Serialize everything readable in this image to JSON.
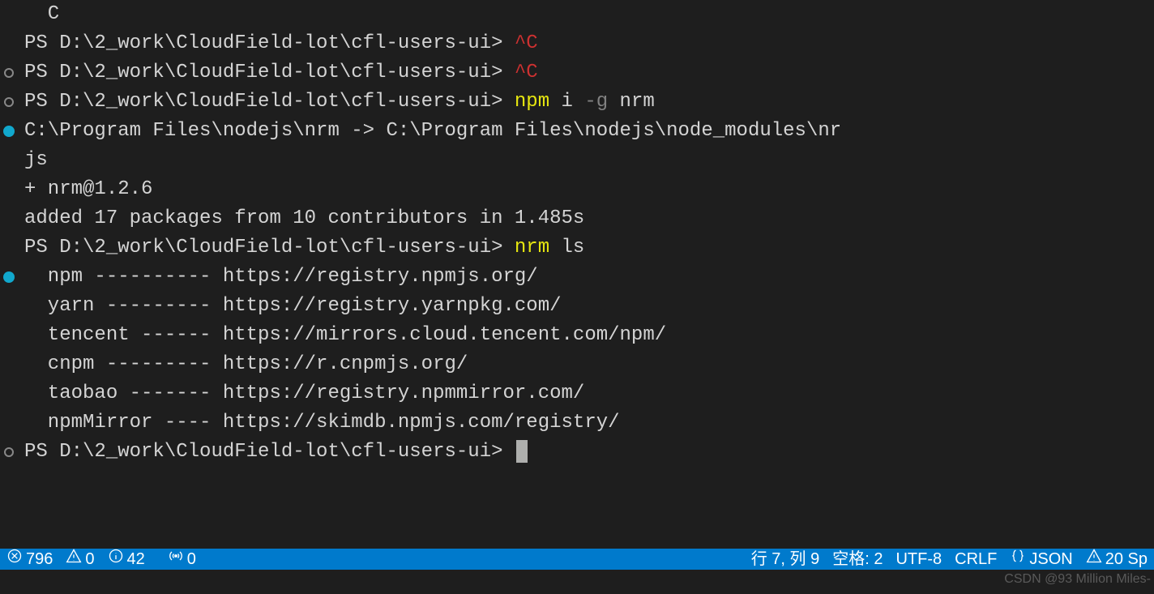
{
  "terminal": {
    "prompt": "PS D:\\2_work\\CloudField-lot\\cfl-users-ui>",
    "lines": [
      {
        "gutter": "",
        "segments": [
          {
            "text": "  C",
            "cls": "white"
          }
        ]
      },
      {
        "gutter": "",
        "segments": [
          {
            "text": "PS D:\\2_work\\CloudField-lot\\cfl-users-ui> ",
            "cls": "white"
          },
          {
            "text": "^C",
            "cls": "red"
          }
        ]
      },
      {
        "gutter": "hollow",
        "segments": [
          {
            "text": "PS D:\\2_work\\CloudField-lot\\cfl-users-ui> ",
            "cls": "white"
          },
          {
            "text": "^C",
            "cls": "red"
          }
        ]
      },
      {
        "gutter": "hollow",
        "segments": [
          {
            "text": "PS D:\\2_work\\CloudField-lot\\cfl-users-ui> ",
            "cls": "white"
          },
          {
            "text": "npm ",
            "cls": "yellow"
          },
          {
            "text": "i ",
            "cls": "white"
          },
          {
            "text": "-g ",
            "cls": "dim"
          },
          {
            "text": "nrm",
            "cls": "white"
          }
        ]
      },
      {
        "gutter": "cyan",
        "segments": [
          {
            "text": "C:\\Program Files\\nodejs\\nrm -> C:\\Program Files\\nodejs\\node_modules\\nr",
            "cls": "white"
          }
        ]
      },
      {
        "gutter": "",
        "segments": [
          {
            "text": "js",
            "cls": "white"
          }
        ]
      },
      {
        "gutter": "",
        "segments": [
          {
            "text": "+ nrm@1.2.6",
            "cls": "white"
          }
        ]
      },
      {
        "gutter": "",
        "segments": [
          {
            "text": "added 17 packages from 10 contributors in 1.485s",
            "cls": "white"
          }
        ]
      },
      {
        "gutter": "",
        "segments": [
          {
            "text": "PS D:\\2_work\\CloudField-lot\\cfl-users-ui> ",
            "cls": "white"
          },
          {
            "text": "nrm ",
            "cls": "yellow"
          },
          {
            "text": "ls",
            "cls": "white"
          }
        ]
      },
      {
        "gutter": "cyan",
        "segments": [
          {
            "text": "  npm ---------- https://registry.npmjs.org/",
            "cls": "white"
          }
        ]
      },
      {
        "gutter": "",
        "segments": [
          {
            "text": "  yarn --------- https://registry.yarnpkg.com/",
            "cls": "white"
          }
        ]
      },
      {
        "gutter": "",
        "segments": [
          {
            "text": "  tencent ------ https://mirrors.cloud.tencent.com/npm/",
            "cls": "white"
          }
        ]
      },
      {
        "gutter": "",
        "segments": [
          {
            "text": "  cnpm --------- https://r.cnpmjs.org/",
            "cls": "white"
          }
        ]
      },
      {
        "gutter": "",
        "segments": [
          {
            "text": "  taobao ------- https://registry.npmmirror.com/",
            "cls": "white"
          }
        ]
      },
      {
        "gutter": "",
        "segments": [
          {
            "text": "  npmMirror ---- https://skimdb.npmjs.com/registry/",
            "cls": "white"
          }
        ]
      },
      {
        "gutter": "hollow",
        "segments": [
          {
            "text": "PS D:\\2_work\\CloudField-lot\\cfl-users-ui> ",
            "cls": "white"
          }
        ],
        "cursor": true
      }
    ]
  },
  "statusbar": {
    "errors_icon": "×",
    "errors": 796,
    "warnings_icon": "⚠",
    "warnings": 0,
    "info_icon": "ⓘ",
    "info": 42,
    "ports_icon": "((·))",
    "ports": 0,
    "position": "行 7,  列 9",
    "spaces": "空格: 2",
    "encoding": "UTF-8",
    "eol": "CRLF",
    "lang_icon": "{}",
    "language": "JSON",
    "right_warn_icon": "⚠",
    "right_count": "20 Sp"
  },
  "watermark": "CSDN @93 Million Miles-"
}
